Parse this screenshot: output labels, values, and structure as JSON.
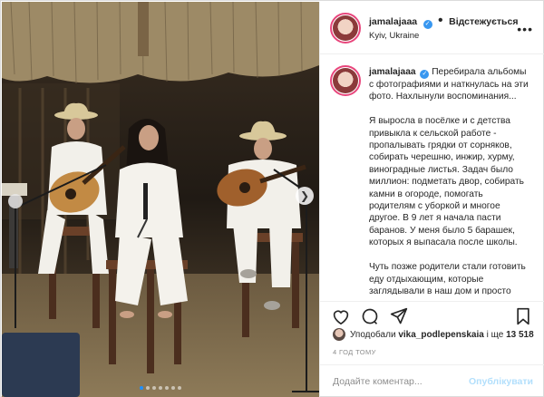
{
  "post": {
    "username": "jamalajaaa",
    "verified_icon": "verified-badge-icon",
    "separator": "•",
    "follow_label": "Відстежується",
    "location": "Kyiv, Ukraine",
    "more_icon": "more-horizontal-icon",
    "caption_username": "jamalajaaa",
    "caption_text": "Перебирала альбомы с фотографиями и наткнулась на эти фото. Нахлынули воспоминания...\n\nЯ выросла в посёлке и с детства привыкла к сельской работе - пропалывать грядки от сорняков, собирать черешню, инжир, хурму, виноградные листья. Задач было миллион: подметать двор, собирать камни в огороде, помогать родителям с уборкой и многое другое. В 9 лет я начала пасти баранов. У меня было 5 барашек, которых я выпасала после школы.\n\nЧуть позже родители стали готовить еду отдыхающим, которые заглядывали в наш дом и просто прохожим и нуждающимся. Не имея своего",
    "actions": {
      "like_icon": "heart-icon",
      "comment_icon": "comment-icon",
      "share_icon": "paper-plane-icon",
      "save_icon": "bookmark-icon"
    },
    "likes": {
      "prefix": "Уподобали",
      "user": "vika_podlepenskaia",
      "middle": "і ще",
      "count": "13 518"
    },
    "time": "4 ГОД ТОМУ",
    "comment": {
      "placeholder": "Додайте коментар...",
      "publish_label": "Опублікувати"
    },
    "carousel": {
      "slides": 7,
      "active_index": 0,
      "next_icon": "chevron-right-icon"
    }
  },
  "colors": {
    "accent": "#3897f0",
    "publish_disabled": "#b2dffc",
    "border": "#dbdbdb"
  }
}
